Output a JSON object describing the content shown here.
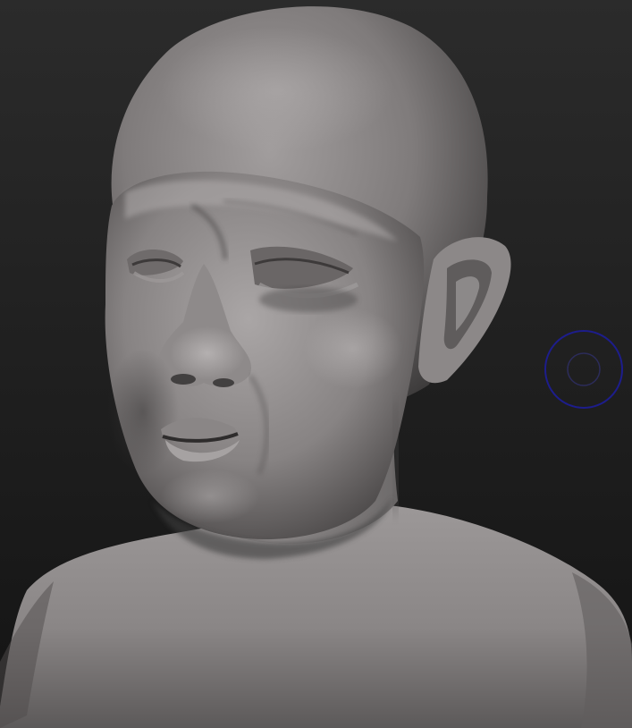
{
  "viewport": {
    "background_top": "#2b2b2b",
    "background_bottom": "#131313"
  },
  "model": {
    "name": "sculpted-bust-head",
    "material_color": "#8a8686",
    "highlight_color": "#b3afaf",
    "shadow_color": "#3a3838"
  },
  "brush_cursor": {
    "icon": "brush-cursor-icon",
    "color": "#1d1d8c"
  }
}
